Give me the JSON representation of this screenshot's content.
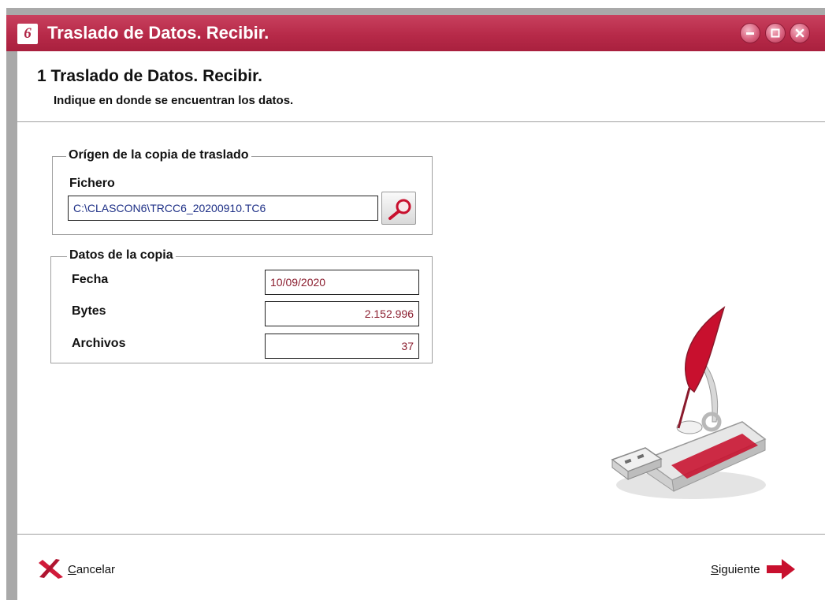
{
  "window": {
    "title": "Traslado de Datos. Recibir.",
    "app_icon_text": "6",
    "controls": {
      "minimize": "minimize-icon",
      "maximize": "maximize-icon",
      "close": "close-icon"
    }
  },
  "header": {
    "title": "1 Traslado de Datos. Recibir.",
    "subtitle": "Indique en donde se encuentran los datos."
  },
  "origin_group": {
    "legend": "Orígen de la copia de traslado",
    "file_label": "Fichero",
    "file_value": "C:\\CLASCON6\\TRCC6_20200910.TC6",
    "browse_icon": "magnifier-icon"
  },
  "data_group": {
    "legend": "Datos de la copia",
    "date_label": "Fecha",
    "date_value": "10/09/2020",
    "bytes_label": "Bytes",
    "bytes_value": "2.152.996",
    "files_label": "Archivos",
    "files_value": "37"
  },
  "footer": {
    "cancel_accel": "C",
    "cancel_rest": "ancelar",
    "next_accel": "S",
    "next_rest": "iguiente",
    "cancel_icon": "cancel-x-icon",
    "next_icon": "arrow-right-icon"
  },
  "illustration": "usb-drive-quill-icon",
  "colors": {
    "titlebar": "#b72a49",
    "accent": "#c8102e",
    "file_text": "#1d2f86",
    "value_text": "#8b1e2f"
  }
}
